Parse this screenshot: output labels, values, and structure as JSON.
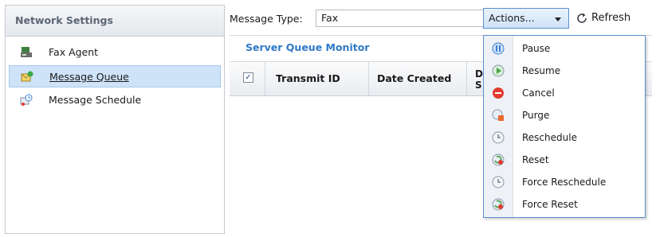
{
  "sidebar": {
    "header": "Network Settings",
    "items": [
      {
        "label": "Fax Agent",
        "icon": "fax-agent-icon",
        "selected": false
      },
      {
        "label": "Message Queue",
        "icon": "message-queue-icon",
        "selected": true
      },
      {
        "label": "Message Schedule",
        "icon": "message-schedule-icon",
        "selected": false
      }
    ]
  },
  "toolbar": {
    "message_type_label": "Message Type:",
    "message_type_value": "Fax",
    "actions_label": "Actions...",
    "refresh_label": "Refresh"
  },
  "main": {
    "section_title": "Server Queue Monitor",
    "columns": [
      "Transmit ID",
      "Date Created"
    ],
    "partial_column": "D S",
    "select_all_checked": true
  },
  "actions_menu": {
    "items": [
      {
        "label": "Pause",
        "icon": "pause-icon",
        "color": "#3c7fd6"
      },
      {
        "label": "Resume",
        "icon": "resume-icon",
        "color": "#47a447"
      },
      {
        "label": "Cancel",
        "icon": "cancel-icon",
        "color": "#e03c31"
      },
      {
        "label": "Purge",
        "icon": "purge-icon",
        "color": "#e9692c"
      },
      {
        "label": "Reschedule",
        "icon": "reschedule-icon",
        "color": "#8a97a8"
      },
      {
        "label": "Reset",
        "icon": "reset-icon",
        "color": "#58a85a"
      },
      {
        "label": "Force Reschedule",
        "icon": "force-reschedule-icon",
        "color": "#8a97a8"
      },
      {
        "label": "Force Reset",
        "icon": "force-reset-icon",
        "color": "#58a85a"
      }
    ]
  },
  "colors": {
    "accent": "#2f79c9",
    "selection": "#cfe3f8",
    "menu_border": "#5a8ed0"
  }
}
